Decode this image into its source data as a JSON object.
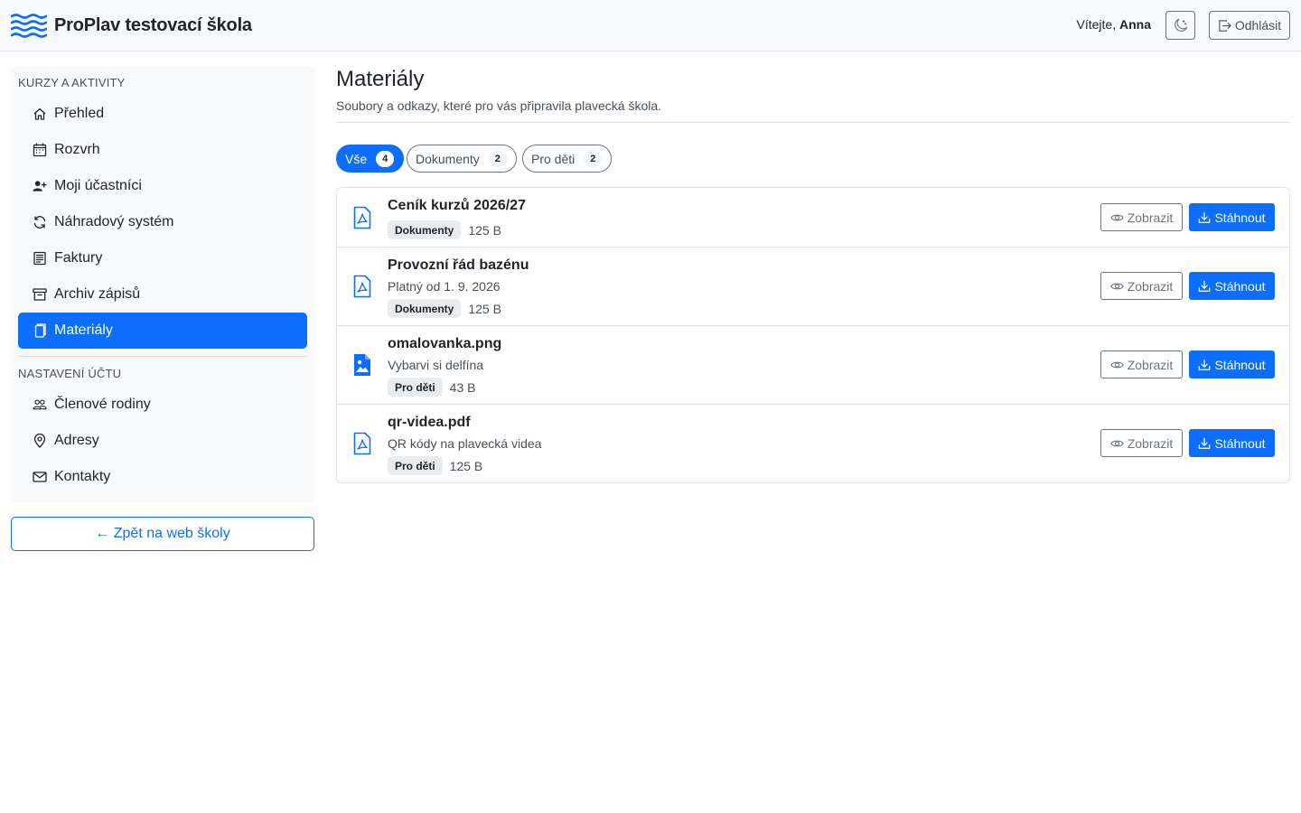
{
  "header": {
    "brand": "ProPlav testovací škola",
    "welcome_prefix": "Vítejte,",
    "user_name": "Anna",
    "logout_label": "Odhlásit",
    "icons": {
      "logo": "waves-icon",
      "theme": "moon-stars-icon",
      "logout": "box-arrow-right-icon"
    }
  },
  "sidebar": {
    "section1": "KURZY A AKTIVITY",
    "items1": [
      {
        "label": "Přehled",
        "icon": "house-icon",
        "active": false
      },
      {
        "label": "Rozvrh",
        "icon": "calendar-icon",
        "active": false
      },
      {
        "label": "Moji účastníci",
        "icon": "person-plus-icon",
        "active": false
      },
      {
        "label": "Náhradový systém",
        "icon": "arrow-repeat-icon",
        "active": false
      },
      {
        "label": "Faktury",
        "icon": "receipt-icon",
        "active": false
      },
      {
        "label": "Archiv zápisů",
        "icon": "archive-icon",
        "active": false
      },
      {
        "label": "Materiály",
        "icon": "files-icon",
        "active": true
      }
    ],
    "section2": "NASTAVENÍ ÚČTU",
    "items2": [
      {
        "label": "Členové rodiny",
        "icon": "people-icon",
        "active": false
      },
      {
        "label": "Adresy",
        "icon": "geo-alt-icon",
        "active": false
      },
      {
        "label": "Kontakty",
        "icon": "envelope-icon",
        "active": false
      }
    ],
    "back_label": "← Zpět na web školy"
  },
  "main": {
    "title": "Materiály",
    "subtitle": "Soubory a odkazy, které pro vás připravila plavecká škola.",
    "filters": [
      {
        "label": "Vše",
        "count": "4",
        "active": true
      },
      {
        "label": "Dokumenty",
        "count": "2",
        "active": false
      },
      {
        "label": "Pro děti",
        "count": "2",
        "active": false
      }
    ],
    "view_label": "Zobrazit",
    "download_label": "Stáhnout",
    "files": [
      {
        "name": "Ceník kurzů 2026/27",
        "description": "",
        "category": "Dokumenty",
        "size": "125 B",
        "icon": "file-pdf-icon"
      },
      {
        "name": "Provozní řád bazénu",
        "description": "Platný od 1. 9. 2026",
        "category": "Dokumenty",
        "size": "125 B",
        "icon": "file-pdf-icon"
      },
      {
        "name": "omalovanka.png",
        "description": "Vybarvi si delfína",
        "category": "Pro děti",
        "size": "43 B",
        "icon": "file-image-icon"
      },
      {
        "name": "qr-videa.pdf",
        "description": "QR kódy na plavecká videa",
        "category": "Pro děti",
        "size": "125 B",
        "icon": "file-pdf-icon"
      }
    ]
  },
  "colors": {
    "primary": "#0d6efd",
    "border": "#dee2e6",
    "sidebar_bg": "#f8f9fa",
    "muted": "#6c757d"
  }
}
